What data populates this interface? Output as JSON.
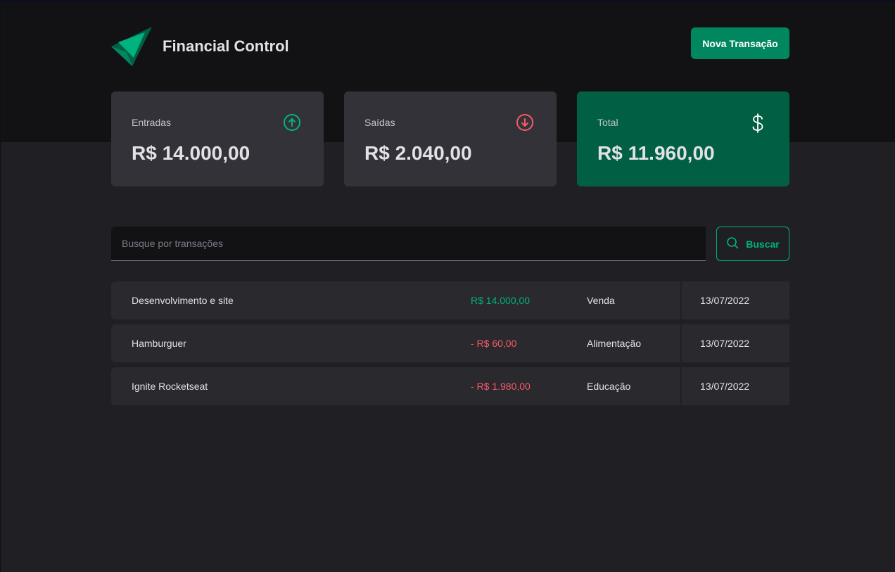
{
  "header": {
    "brand": "Financial Control",
    "new_transaction_label": "Nova Transação"
  },
  "summary": {
    "income": {
      "label": "Entradas",
      "value": "R$ 14.000,00",
      "icon": "arrow-circle-up-icon"
    },
    "outcome": {
      "label": "Saídas",
      "value": "R$ 2.040,00",
      "icon": "arrow-circle-down-icon"
    },
    "total": {
      "label": "Total",
      "value": "R$ 11.960,00",
      "icon": "currency-dollar-icon"
    }
  },
  "search": {
    "placeholder": "Busque por transações",
    "value": "",
    "button_label": "Buscar"
  },
  "transactions": [
    {
      "description": "Desenvolvimento e site",
      "price": "R$ 14.000,00",
      "type": "income",
      "category": "Venda",
      "date": "13/07/2022"
    },
    {
      "description": "Hamburguer",
      "price": "- R$ 60,00",
      "type": "outcome",
      "category": "Alimentação",
      "date": "13/07/2022"
    },
    {
      "description": "Ignite Rocketseat",
      "price": "- R$ 1.980,00",
      "type": "outcome",
      "category": "Educação",
      "date": "13/07/2022"
    }
  ],
  "colors": {
    "brand_green": "#00875f",
    "income_green": "#00b37e",
    "outcome_red": "#f75a68",
    "total_card": "#015f43",
    "card_bg": "#323238",
    "row_bg": "#29292e",
    "header_bg": "#121214",
    "page_bg": "#202024"
  }
}
